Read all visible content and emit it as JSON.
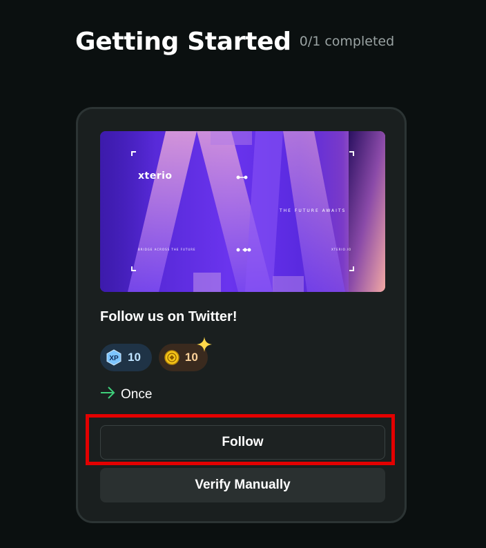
{
  "header": {
    "title": "Getting Started",
    "progress": "0/1 completed"
  },
  "task": {
    "banner": {
      "brand": "xterio",
      "tagline": "THE FUTURE AWAITS",
      "small_left": "BRIDGE ACROSS THE FUTURE",
      "small_right": "XTERIO.IO"
    },
    "title": "Follow us on Twitter!",
    "rewards": [
      {
        "icon": "xp-icon",
        "icon_label": "XP",
        "value": "10"
      },
      {
        "icon": "coin-icon",
        "value": "10"
      }
    ],
    "frequency": {
      "icon": "arrow-right-icon",
      "label": "Once"
    },
    "buttons": {
      "follow": "Follow",
      "verify": "Verify Manually"
    }
  },
  "colors": {
    "background": "#0b1010",
    "card": "#1a1f1f",
    "highlight": "#e30000",
    "arrow": "#3ecf7a"
  }
}
